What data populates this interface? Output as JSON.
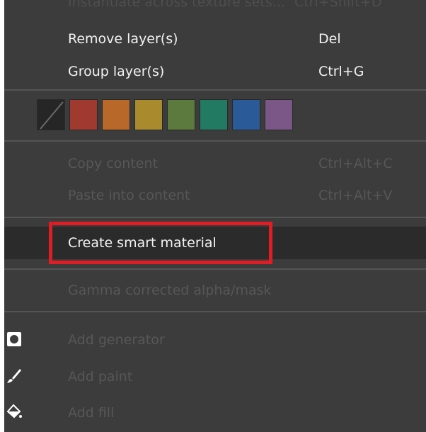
{
  "menu": {
    "top_cut": {
      "label": "Instantiate across texture sets...",
      "shortcut": "Ctrl+Shift+D"
    },
    "remove_layers": {
      "label": "Remove layer(s)",
      "shortcut": "Del"
    },
    "group_layers": {
      "label": "Group layer(s)",
      "shortcut": "Ctrl+G"
    },
    "colors": {
      "none": "none",
      "swatches": [
        {
          "name": "red",
          "hex": "#a13a2e"
        },
        {
          "name": "orange",
          "hex": "#b8692a"
        },
        {
          "name": "yellow",
          "hex": "#a98b2d"
        },
        {
          "name": "green",
          "hex": "#5d7a3e"
        },
        {
          "name": "teal",
          "hex": "#237a63"
        },
        {
          "name": "blue",
          "hex": "#2a5b98"
        },
        {
          "name": "purple",
          "hex": "#7a5786"
        }
      ]
    },
    "copy_content": {
      "label": "Copy content",
      "shortcut": "Ctrl+Alt+C"
    },
    "paste_into_content": {
      "label": "Paste into content",
      "shortcut": "Ctrl+Alt+V"
    },
    "create_smart_material": {
      "label": "Create smart material"
    },
    "gamma_corrected": {
      "label": "Gamma corrected alpha/mask"
    },
    "add_generator": {
      "label": "Add generator",
      "icon": "generator-icon"
    },
    "add_paint": {
      "label": "Add paint",
      "icon": "brush-icon"
    },
    "add_fill": {
      "label": "Add fill",
      "icon": "paint-bucket-icon"
    }
  },
  "highlight": {
    "color": "#e31b23"
  }
}
